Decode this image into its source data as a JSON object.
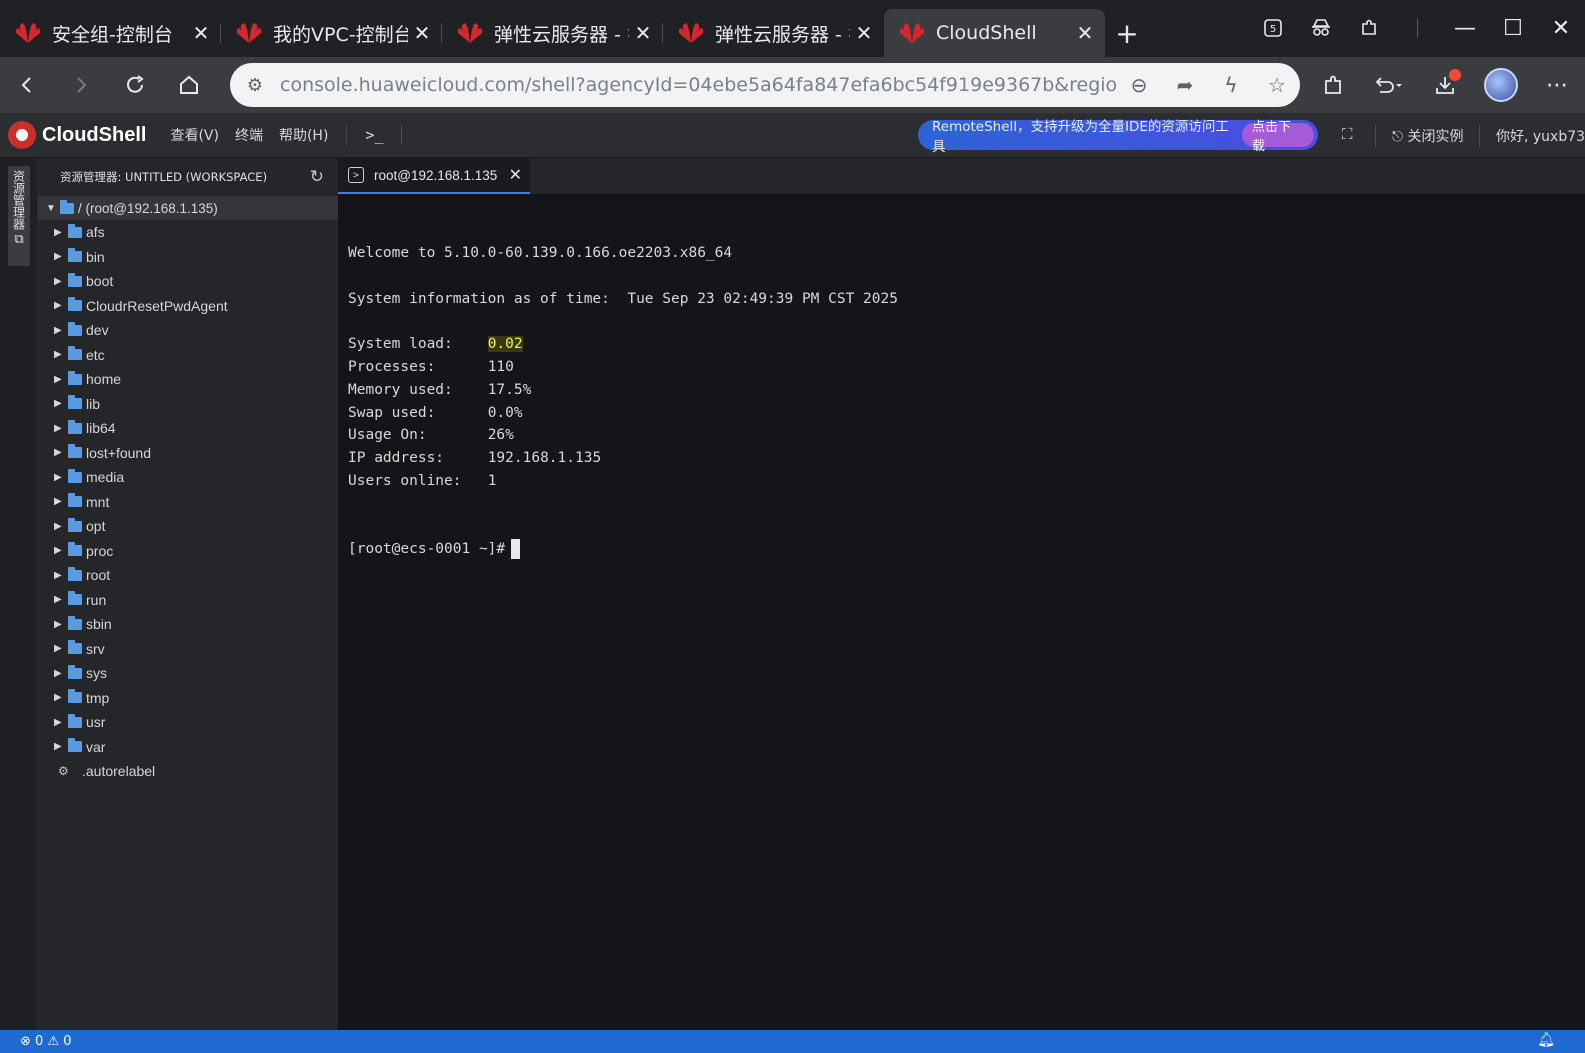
{
  "browser": {
    "tabs": [
      {
        "title": "安全组-控制台",
        "active": false
      },
      {
        "title": "我的VPC-控制台",
        "active": false
      },
      {
        "title": "弹性云服务器 - 扌",
        "active": false
      },
      {
        "title": "弹性云服务器 - 扌",
        "active": false
      },
      {
        "title": "CloudShell",
        "active": true
      }
    ],
    "new_tab_label": "+",
    "close_glyph": "✕",
    "url": "console.huaweicloud.com/shell?agencyId=04ebe5a64fa847efa6bc54f919e9367b&region=cn...",
    "icons": {
      "back": "chevron-left-icon",
      "forward": "chevron-right-icon",
      "reload": "reload-icon",
      "home": "home-icon"
    },
    "window_controls": {
      "minimize": "—",
      "maximize": "☐",
      "close": "✕"
    }
  },
  "cloudshell": {
    "brand": "CloudShell",
    "menus": [
      "查看(V)",
      "终端",
      "帮助(H)"
    ],
    "terminal_glyph": ">_",
    "banner_text": "RemoteShell，支持升级为全量IDE的资源访问工具",
    "banner_button": "点击下载",
    "close_instance": "关闭实例",
    "greeting": "你好, yuxb73",
    "accent_color": "#3b82f6",
    "status_bar_color": "#1e6ad2"
  },
  "activity": {
    "explorer_label": "资源管理器"
  },
  "explorer": {
    "title": "资源管理器: UNTITLED (WORKSPACE)",
    "root": "/ (root@192.168.1.135)",
    "folders": [
      "afs",
      "bin",
      "boot",
      "CloudrResetPwdAgent",
      "dev",
      "etc",
      "home",
      "lib",
      "lib64",
      "lost+found",
      "media",
      "mnt",
      "opt",
      "proc",
      "root",
      "run",
      "sbin",
      "srv",
      "sys",
      "tmp",
      "usr",
      "var"
    ],
    "files": [
      ".autorelabel"
    ]
  },
  "editor": {
    "tab_title": "root@192.168.1.135",
    "tab_icon": ">"
  },
  "terminal": {
    "welcome": "Welcome to 5.10.0-60.139.0.166.oe2203.x86_64",
    "sysinfo": "System information as of time:  Tue Sep 23 02:49:39 PM CST 2025",
    "stats": [
      {
        "label": "System load:    ",
        "value": "0.02",
        "highlight": true
      },
      {
        "label": "Processes:      ",
        "value": "110",
        "highlight": false
      },
      {
        "label": "Memory used:    ",
        "value": "17.5%",
        "highlight": false
      },
      {
        "label": "Swap used:      ",
        "value": "0.0%",
        "highlight": false
      },
      {
        "label": "Usage On:       ",
        "value": "26%",
        "highlight": false
      },
      {
        "label": "IP address:     ",
        "value": "192.168.1.135",
        "highlight": false
      },
      {
        "label": "Users online:   ",
        "value": "1",
        "highlight": false
      }
    ],
    "prompt": "[root@ecs-0001 ~]#"
  },
  "status": {
    "errors": "0",
    "warnings": "0"
  }
}
